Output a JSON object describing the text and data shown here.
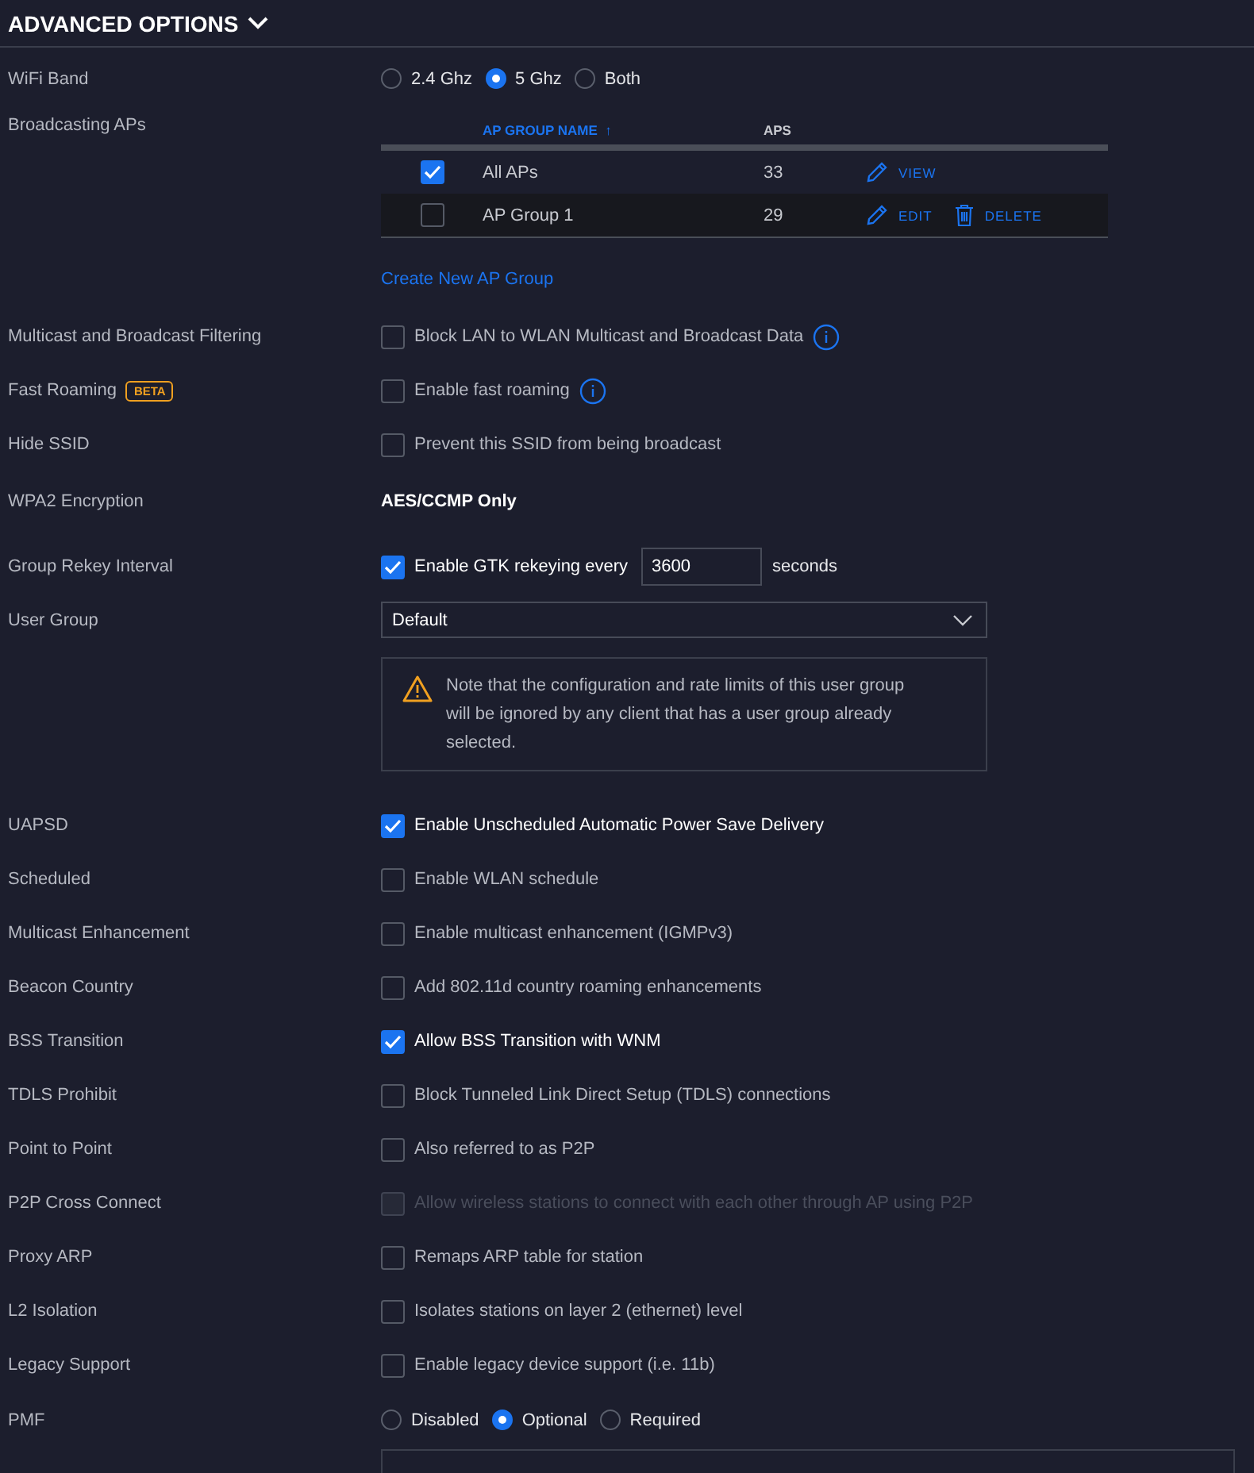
{
  "section": {
    "title": "ADVANCED OPTIONS",
    "expanded": true
  },
  "rows": [
    {
      "kind": "radio",
      "label": "WiFi Band",
      "options": [
        {
          "label": "2.4 Ghz",
          "selected": false
        },
        {
          "label": "5 Ghz",
          "selected": true
        },
        {
          "label": "Both",
          "selected": false
        }
      ]
    },
    {
      "kind": "table",
      "label": "Broadcasting APs",
      "columns": [
        {
          "label": "AP GROUP NAME",
          "sorted": true,
          "sort_indicator": "↑"
        },
        {
          "label": "APS",
          "sorted": false
        }
      ],
      "groups": [
        {
          "checked": true,
          "name": "All APs",
          "aps": "33",
          "actions": [
            {
              "kind": "view",
              "label": "VIEW"
            }
          ]
        },
        {
          "checked": false,
          "name": "AP Group 1",
          "aps": "29",
          "actions": [
            {
              "kind": "edit",
              "label": "EDIT"
            },
            {
              "kind": "delete",
              "label": "DELETE"
            }
          ]
        }
      ],
      "link": "Create New AP Group"
    },
    {
      "kind": "checkbox",
      "label": "Multicast and Broadcast Filtering",
      "text": "Block LAN to WLAN Multicast and Broadcast Data",
      "checked": false,
      "disabled": false,
      "info": true
    },
    {
      "kind": "checkbox",
      "label": "Fast Roaming",
      "badge": "BETA",
      "text": "Enable fast roaming",
      "checked": false,
      "disabled": false,
      "info": true
    },
    {
      "kind": "checkbox",
      "label": "Hide SSID",
      "text": "Prevent this SSID from being broadcast",
      "checked": false,
      "disabled": false
    },
    {
      "kind": "value",
      "label": "WPA2 Encryption",
      "value": "AES/CCMP Only"
    },
    {
      "kind": "checkbox-input",
      "label": "Group Rekey Interval",
      "text": "Enable GTK rekeying every",
      "checked": true,
      "value": "3600",
      "suffix": "seconds"
    },
    {
      "kind": "select",
      "label": "User Group",
      "value": "Default",
      "note": "Note that the configuration and rate limits of this user group will be ignored by any client that has a user group already selected."
    },
    {
      "kind": "checkbox",
      "label": "UAPSD",
      "text": "Enable Unscheduled Automatic Power Save Delivery",
      "checked": true,
      "disabled": false
    },
    {
      "kind": "checkbox",
      "label": "Scheduled",
      "text": "Enable WLAN schedule",
      "checked": false,
      "disabled": false
    },
    {
      "kind": "checkbox",
      "label": "Multicast Enhancement",
      "text": "Enable multicast enhancement (IGMPv3)",
      "checked": false,
      "disabled": false
    },
    {
      "kind": "checkbox",
      "label": "Beacon Country",
      "text": "Add 802.11d country roaming enhancements",
      "checked": false,
      "disabled": false
    },
    {
      "kind": "checkbox",
      "label": "BSS Transition",
      "text": "Allow BSS Transition with WNM",
      "checked": true,
      "disabled": false
    },
    {
      "kind": "checkbox",
      "label": "TDLS Prohibit",
      "text": "Block Tunneled Link Direct Setup (TDLS) connections",
      "checked": false,
      "disabled": false
    },
    {
      "kind": "checkbox",
      "label": "Point to Point",
      "text": "Also referred to as P2P",
      "checked": false,
      "disabled": false
    },
    {
      "kind": "checkbox",
      "label": "P2P Cross Connect",
      "text": "Allow wireless stations to connect with each other through AP using P2P",
      "checked": false,
      "disabled": true
    },
    {
      "kind": "checkbox",
      "label": "Proxy ARP",
      "text": "Remaps ARP table for station",
      "checked": false,
      "disabled": false
    },
    {
      "kind": "checkbox",
      "label": "L2 Isolation",
      "text": "Isolates stations on layer 2 (ethernet) level",
      "checked": false,
      "disabled": false
    },
    {
      "kind": "checkbox",
      "label": "Legacy Support",
      "text": "Enable legacy device support (i.e. 11b)",
      "checked": false,
      "disabled": false
    },
    {
      "kind": "radio",
      "label": "PMF",
      "options": [
        {
          "label": "Disabled",
          "selected": false
        },
        {
          "label": "Optional",
          "selected": true
        },
        {
          "label": "Required",
          "selected": false
        }
      ]
    },
    {
      "kind": "field"
    }
  ]
}
